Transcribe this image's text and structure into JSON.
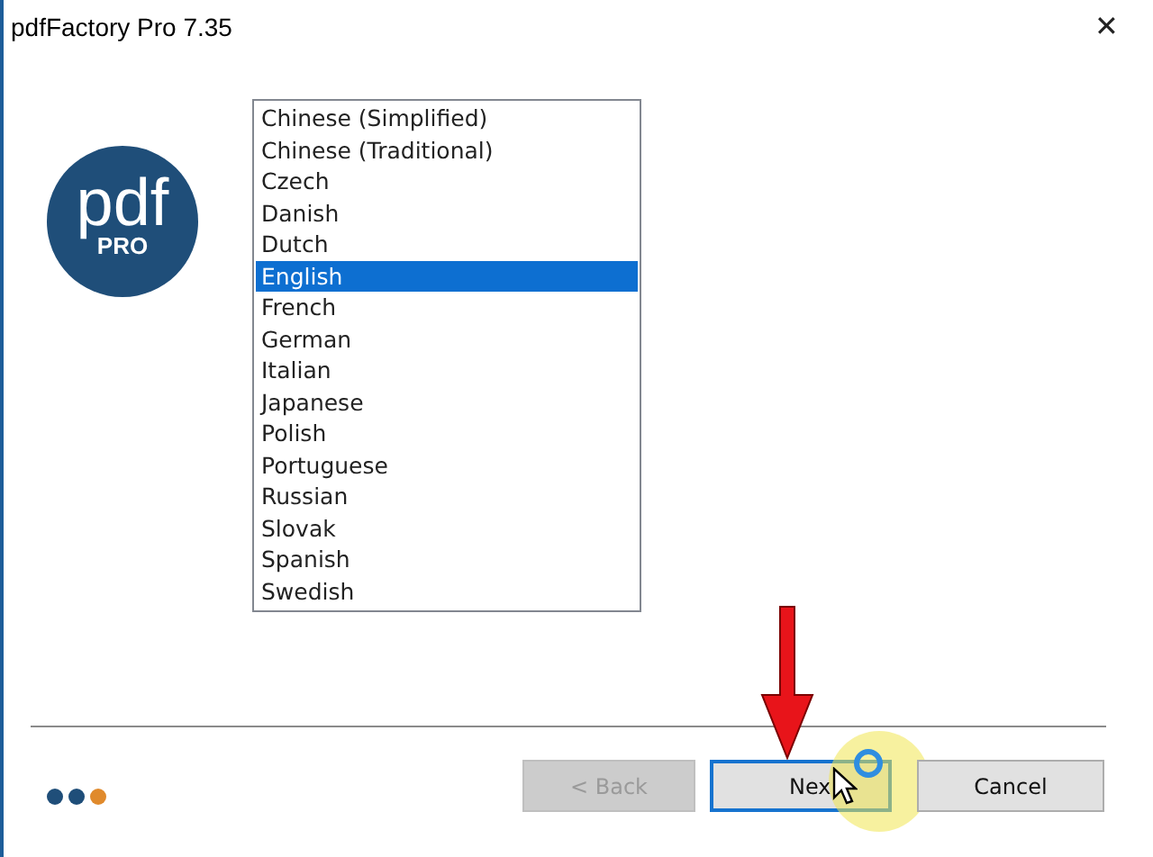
{
  "window": {
    "title": "pdfFactory Pro 7.35",
    "close": "✕"
  },
  "logo": {
    "text": "pdf",
    "subtext": "PRO"
  },
  "languages": [
    {
      "label": "Chinese (Simplified)",
      "selected": false
    },
    {
      "label": "Chinese (Traditional)",
      "selected": false
    },
    {
      "label": "Czech",
      "selected": false
    },
    {
      "label": "Danish",
      "selected": false
    },
    {
      "label": "Dutch",
      "selected": false
    },
    {
      "label": "English",
      "selected": true
    },
    {
      "label": "French",
      "selected": false
    },
    {
      "label": "German",
      "selected": false
    },
    {
      "label": "Italian",
      "selected": false
    },
    {
      "label": "Japanese",
      "selected": false
    },
    {
      "label": "Polish",
      "selected": false
    },
    {
      "label": "Portuguese",
      "selected": false
    },
    {
      "label": "Russian",
      "selected": false
    },
    {
      "label": "Slovak",
      "selected": false
    },
    {
      "label": "Spanish",
      "selected": false
    },
    {
      "label": "Swedish",
      "selected": false
    }
  ],
  "progress_dots": [
    {
      "color": "#1f4e79"
    },
    {
      "color": "#1f4e79"
    },
    {
      "color": "#e08a2c"
    }
  ],
  "buttons": [
    {
      "label": "< Back",
      "disabled": true,
      "focused": false
    },
    {
      "label": "Nex",
      "disabled": false,
      "focused": true
    },
    {
      "label": "Cancel",
      "disabled": false,
      "focused": false
    }
  ]
}
